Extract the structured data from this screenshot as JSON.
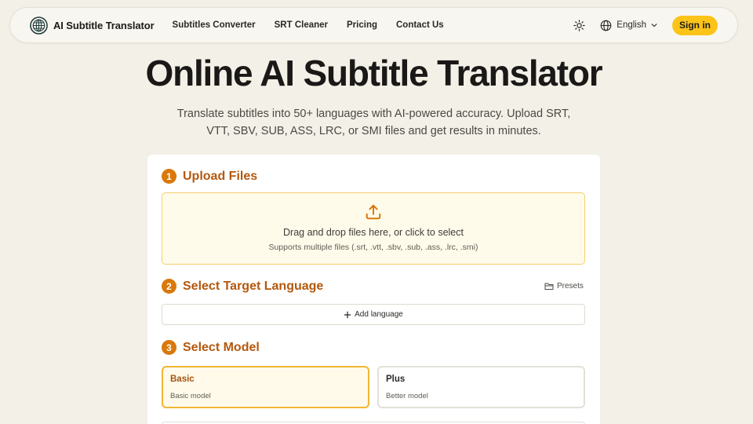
{
  "nav": {
    "brand": "AI Subtitle Translator",
    "links": [
      "Subtitles Converter",
      "SRT Cleaner",
      "Pricing",
      "Contact Us"
    ],
    "language": "English",
    "sign_in": "Sign in"
  },
  "hero": {
    "title": "Online AI Subtitle Translator",
    "subtitle": "Translate subtitles into 50+ languages with AI-powered accuracy. Upload SRT, VTT, SBV, SUB, ASS, LRC, or SMI files and get results in minutes."
  },
  "steps": {
    "upload": {
      "number": "1",
      "title": "Upload Files",
      "drop_text": "Drag and drop files here, or click to select",
      "hint": "Supports multiple files (.srt, .vtt, .sbv, .sub, .ass, .lrc, .smi)"
    },
    "language": {
      "number": "2",
      "title": "Select Target Language",
      "presets": "Presets",
      "add_language": "Add language"
    },
    "model": {
      "number": "3",
      "title": "Select Model",
      "options": [
        {
          "name": "Basic",
          "desc": "Basic model",
          "selected": true
        },
        {
          "name": "Plus",
          "desc": "Better model",
          "selected": false
        }
      ]
    }
  },
  "icons": {
    "logo": "globe-logo-icon",
    "theme": "sun-icon",
    "language": "globe-icon",
    "chevron": "chevron-down-icon",
    "upload": "upload-icon",
    "presets": "folder-icon",
    "add": "plus-icon"
  },
  "colors": {
    "accent": "#fcc419",
    "step_badge": "#d9780b",
    "step_title": "#b4580d",
    "background": "#f3f0e8"
  }
}
